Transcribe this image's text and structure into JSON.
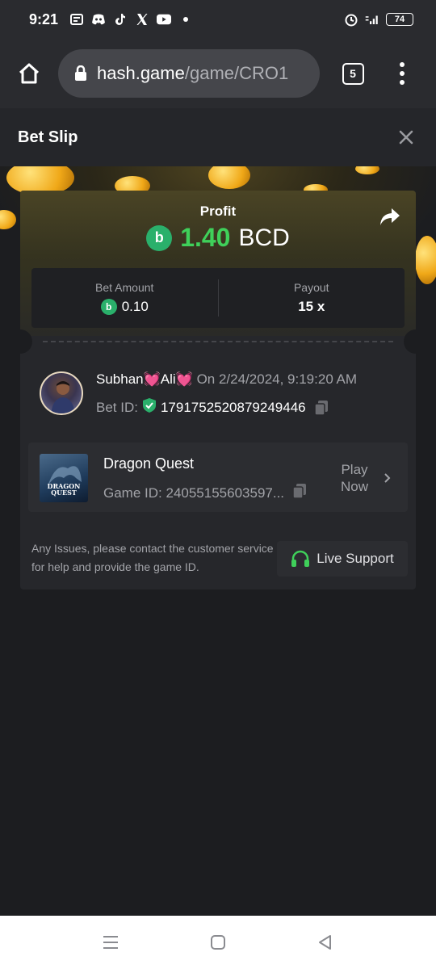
{
  "status_bar": {
    "time": "9:21",
    "battery": "74",
    "icons": [
      "news-icon",
      "discord-icon",
      "tiktok-icon",
      "x-icon",
      "youtube-icon",
      "alarm-icon",
      "signal-icon"
    ]
  },
  "browser": {
    "url_host": "hash.game",
    "url_path": "/game/CRO1",
    "tab_count": "5"
  },
  "header": {
    "title": "Bet Slip"
  },
  "profit": {
    "label": "Profit",
    "value": "1.40",
    "currency": "BCD",
    "value_color": "#3fd05a"
  },
  "stats": {
    "bet_amount_label": "Bet Amount",
    "bet_amount_value": "0.10",
    "payout_label": "Payout",
    "payout_value": "15 x"
  },
  "user": {
    "name": "Subhan💓Ali💓",
    "time": "On 2/24/2024, 9:19:20 AM",
    "bet_id_label": "Bet ID:",
    "bet_id": "1791752520879249446"
  },
  "game": {
    "thumb_text": "DRAGON QUEST",
    "name": "Dragon Quest",
    "game_id_label": "Game ID:",
    "game_id": "24055155603597...",
    "play_label": "Play Now"
  },
  "support": {
    "text": "Any Issues, please contact the customer service for help and provide the game ID.",
    "button_label": "Live Support",
    "icon_color": "#3fd05a"
  },
  "colors": {
    "accent_green": "#3fd05a",
    "bcd_icon": "#2ab06b",
    "background": "#1c1d20"
  }
}
